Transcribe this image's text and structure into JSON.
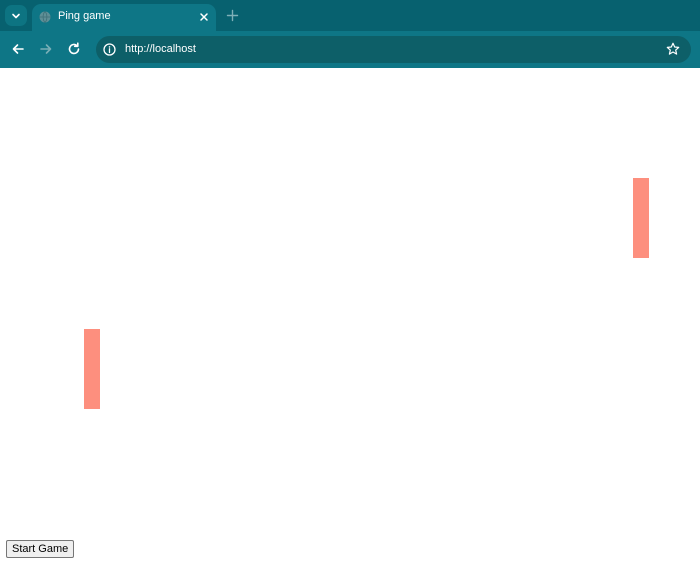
{
  "browser": {
    "tab": {
      "title": "Ping game"
    },
    "address_bar": {
      "url": "http://localhost"
    },
    "icons": [
      "chevron-down-icon",
      "globe-icon",
      "close-icon",
      "plus-icon",
      "back-arrow-icon",
      "forward-arrow-icon",
      "reload-icon",
      "info-icon",
      "star-icon"
    ],
    "colors": {
      "tabstrip": "#07616f",
      "toolbar": "#0e7686",
      "omnibox": "#0d5f68"
    }
  },
  "game": {
    "paddle_color": "#fd8f7e",
    "start_button_label": "Start Game"
  }
}
